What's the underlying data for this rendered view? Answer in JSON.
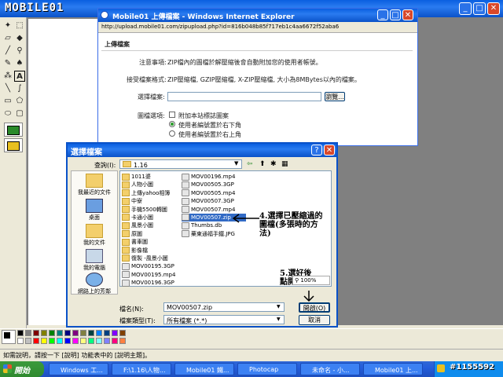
{
  "logo": {
    "text": "MOBILE01"
  },
  "ie": {
    "title": "Mobile01 上傳檔案 - Windows Internet Explorer",
    "address": "http://upload.mobile01.com/zipupload.php?id=816b048b85f717eb1c4aa6672f52aba6",
    "section_title": "上傳檔案",
    "note_label": "注意事項:",
    "note_text": "ZIP檔內的圖檔於解壓縮後會自動附加您的使用者帳號。",
    "formats_label": "接受檔案格式:",
    "formats_text": "ZIP壓縮檔, GZIP壓縮檔, X-ZIP壓縮檔, 大小為8MBytes以內的檔案。",
    "choose_label": "選擇檔案:",
    "browse_btn": "瀏覽...",
    "options_label": "圖檔選項:",
    "opt_watermark": "附加本站標誌圖案",
    "opt_bottom_right": "使用者編號置於右下角",
    "opt_top_right": "使用者編號置於右上角"
  },
  "dialog": {
    "title": "選擇檔案",
    "lookin_label": "查詢(I):",
    "lookin_value": "1.16",
    "places": [
      {
        "label": "我最近的文件"
      },
      {
        "label": "桌面"
      },
      {
        "label": "我的文件"
      },
      {
        "label": "我的電腦"
      },
      {
        "label": "網路上的芳鄰"
      }
    ],
    "files_col1": [
      {
        "name": "1011婆",
        "type": "folder"
      },
      {
        "name": "人物小圖",
        "type": "folder"
      },
      {
        "name": "上傳yahoo相簿",
        "type": "folder"
      },
      {
        "name": "中寮",
        "type": "folder"
      },
      {
        "name": "手機5500轉圖",
        "type": "folder"
      },
      {
        "name": "卡通小圖",
        "type": "folder"
      },
      {
        "name": "風景小圖",
        "type": "folder"
      },
      {
        "name": "原圖",
        "type": "folder"
      },
      {
        "name": "書車圖",
        "type": "folder"
      },
      {
        "name": "影像檔",
        "type": "folder"
      },
      {
        "name": "復製 -風景小圖",
        "type": "folder"
      },
      {
        "name": "MOV00195.3GP",
        "type": "file"
      },
      {
        "name": "MOV00195.mp4",
        "type": "file"
      },
      {
        "name": "MOV00196.3GP",
        "type": "file"
      }
    ],
    "files_col2": [
      {
        "name": "MOV00196.mp4",
        "type": "file"
      },
      {
        "name": "MOV00505.3GP",
        "type": "file"
      },
      {
        "name": "MOV00505.mp4",
        "type": "file"
      },
      {
        "name": "MOV00507.3GP",
        "type": "file"
      },
      {
        "name": "MOV00507.mp4",
        "type": "file"
      },
      {
        "name": "MOV00507.zip",
        "type": "file",
        "selected": true
      },
      {
        "name": "Thumbs.db",
        "type": "file"
      },
      {
        "name": "藥東通福手鐵.JPG",
        "type": "file"
      }
    ],
    "filename_label": "檔名(N):",
    "filename_value": "MOV00507.zip",
    "filetype_label": "檔案類型(T):",
    "filetype_value": "所有檔案 (*.*)",
    "open_btn": "開啟(O)",
    "cancel_btn": "取消",
    "zoom": "100%"
  },
  "annotations": {
    "step4_line1": "4.選擇已壓縮過的",
    "step4_line2": "圖檔(多張時的方",
    "step4_line3": "法)",
    "step5_line1": "5.選好後",
    "step5_line2": "點開啟"
  },
  "status": {
    "text": "如需說明，請按一下 [說明] 功能表中的 [說明主題]。"
  },
  "taskbar": {
    "start": "開始",
    "tasks": [
      "Windows 工...",
      "F:\\1.16\\人物...",
      "Mobile01 鐵...",
      "Photocap",
      "未命名 - 小...",
      "Mobile01 上..."
    ],
    "watermark": "#1155592"
  },
  "colors": {
    "xp_blue": "#0a52c8",
    "selection": "#316ac5",
    "taskbar": "#245ddb"
  },
  "palette": [
    "#000000",
    "#808080",
    "#800000",
    "#808000",
    "#008000",
    "#008080",
    "#000080",
    "#800080",
    "#808040",
    "#004040",
    "#0080ff",
    "#004080",
    "#8000ff",
    "#804000",
    "#ffffff",
    "#c0c0c0",
    "#ff0000",
    "#ffff00",
    "#00ff00",
    "#00ffff",
    "#0000ff",
    "#ff00ff",
    "#ffff80",
    "#00ff80",
    "#80ffff",
    "#8080ff",
    "#ff0080",
    "#ff8040"
  ]
}
